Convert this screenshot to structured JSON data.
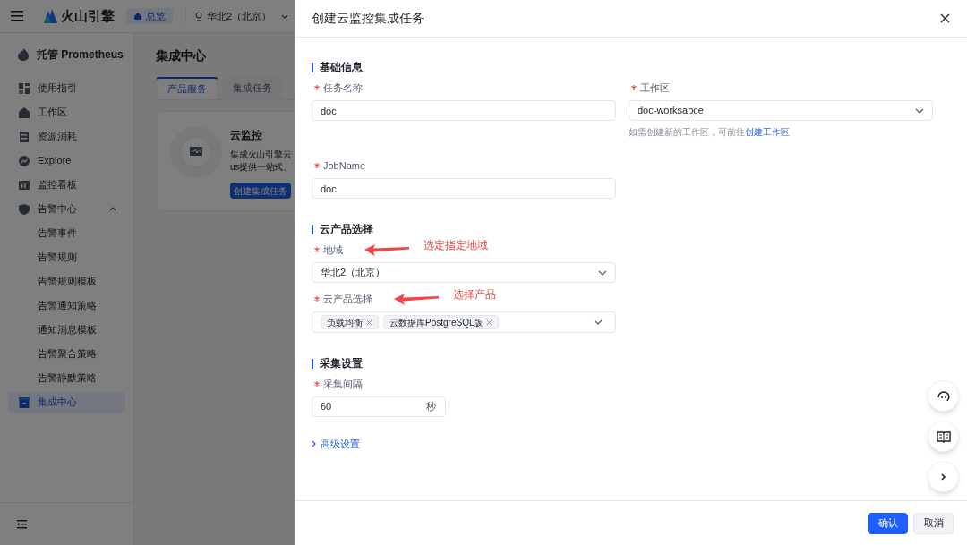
{
  "topbar": {
    "logo_text": "火山引擎",
    "home_tab": "总览",
    "region": "华北2（北京）"
  },
  "sidebar": {
    "title": "托管 Prometheus",
    "items": [
      {
        "label": "使用指引",
        "selected": false
      },
      {
        "label": "工作区",
        "selected": false
      },
      {
        "label": "资源消耗",
        "selected": false
      },
      {
        "label": "Explore",
        "selected": false
      },
      {
        "label": "监控看板",
        "selected": false
      },
      {
        "label": "告警中心",
        "selected": false,
        "expanded": true,
        "children": [
          {
            "label": "告警事件",
            "selected": false
          },
          {
            "label": "告警规则",
            "selected": false
          },
          {
            "label": "告警规则模板",
            "selected": false
          },
          {
            "label": "告警通知策略",
            "selected": false
          },
          {
            "label": "通知消息模板",
            "selected": false
          },
          {
            "label": "告警聚合策略",
            "selected": false
          },
          {
            "label": "告警静默策略",
            "selected": false
          }
        ]
      },
      {
        "label": "集成中心",
        "selected": true
      }
    ]
  },
  "main": {
    "title": "集成中心",
    "tabs": [
      {
        "label": "产品服务",
        "selected": true
      },
      {
        "label": "集成任务",
        "selected": false
      }
    ],
    "card": {
      "title": "云监控",
      "description": [
        "集成火山引擎云",
        "us提供一站式、"
      ],
      "button": "创建集成任务"
    }
  },
  "drawer": {
    "title": "创建云监控集成任务",
    "sections": [
      {
        "title": "基础信息",
        "fields": [
          {
            "kind": "input",
            "label": "任务名称",
            "required": true,
            "value": "doc"
          },
          {
            "kind": "select",
            "label": "工作区",
            "required": true,
            "value": "doc-worksapce",
            "hint": "如需创建新的工作区，可前往",
            "hint_link": "创建工作区"
          },
          {
            "kind": "input",
            "label": "JobName",
            "required": true,
            "value": "doc"
          }
        ]
      },
      {
        "title": "云产品选择",
        "fields": [
          {
            "kind": "select",
            "label": "地域",
            "required": true,
            "value": "华北2（北京）",
            "annotation": "选定指定地域"
          },
          {
            "kind": "multiselect",
            "label": "云产品选择",
            "required": true,
            "tags": [
              "负载均衡",
              "云数据库PostgreSQL版"
            ],
            "annotation": "选择产品"
          }
        ]
      },
      {
        "title": "采集设置",
        "fields": [
          {
            "kind": "suffix_input",
            "label": "采集间隔",
            "required": true,
            "value": "60",
            "suffix": "秒"
          }
        ]
      }
    ],
    "advanced": "高级设置",
    "buttons": [
      {
        "label": "确认",
        "kind": "primary"
      },
      {
        "label": "取消",
        "kind": "secondary"
      }
    ]
  }
}
